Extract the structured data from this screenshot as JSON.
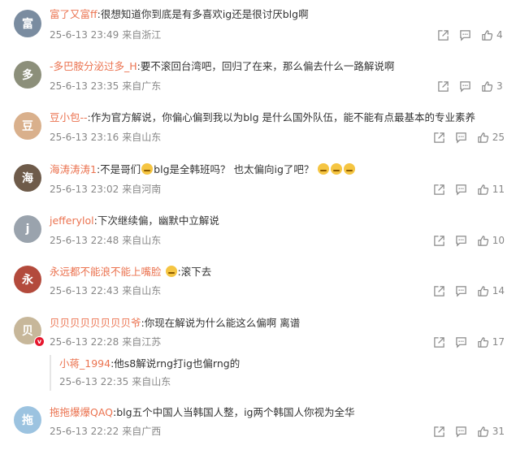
{
  "comments": [
    {
      "user": "富了又富ff",
      "text": ":很想知道你到底是有多喜欢ig还是很讨厌blg啊",
      "time": "25-6-13 23:49",
      "loc": "来自浙江",
      "likes": "4",
      "avatar_color": "#7a8ca0"
    },
    {
      "user": "-多巴胺分泌过多_H",
      "text": ":要不滚回台湾吧，回归了在来，那么偏去什么一路解说啊",
      "time": "25-6-13 23:35",
      "loc": "来自广东",
      "likes": "3",
      "avatar_color": "#8c8f7a"
    },
    {
      "user": "豆小包--",
      "text": ":作为官方解说，你偏心偏到我以为blg 是什么国外队伍，能不能有点最基本的专业素养",
      "time": "25-6-13 23:16",
      "loc": "来自山东",
      "likes": "25",
      "avatar_color": "#d9b08c"
    },
    {
      "user": "海涛涛涛1",
      "text": ":不是哥们",
      "text2": "blg是全韩班吗？ 也太偏向ig了吧？",
      "time": "25-6-13 23:02",
      "loc": "来自河南",
      "likes": "11",
      "avatar_color": "#6e5b4a"
    },
    {
      "user": "jefferylol",
      "text": ":下次继续偏，幽默中立解说",
      "time": "25-6-13 22:48",
      "loc": "来自山东",
      "likes": "10",
      "avatar_color": "#9aa3ad"
    },
    {
      "user": "永远都不能浪不能上嘴脸",
      "text": ":滚下去",
      "time": "25-6-13 22:43",
      "loc": "来自山东",
      "likes": "14",
      "avatar_color": "#b34a3c"
    },
    {
      "user": "贝贝贝贝贝贝贝贝爷",
      "text": ":你现在解说为什么能这么偏啊 离谱",
      "time": "25-6-13 22:28",
      "loc": "来自江苏",
      "likes": "17",
      "avatar_color": "#c7b79a"
    },
    {
      "user": "拖拖爆爆QAQ",
      "text": ":blg五个中国人当韩国人整，ig两个韩国人你视为全华",
      "time": "25-6-13 22:22",
      "loc": "来自广西",
      "likes": "31",
      "avatar_color": "#9cc3e0"
    }
  ],
  "reply": {
    "user": "小蒋_1994",
    "text": ":他s8解说rng打ig也偏rng的",
    "time": "25-6-13 22:35",
    "loc": "来自山东"
  },
  "icons": {
    "share": "share-icon",
    "comment": "comment-icon",
    "like": "thumbs-up-icon",
    "badge": "verified-badge-icon"
  },
  "colors": {
    "username": "#eb7350",
    "text": "#333333",
    "meta": "#888888",
    "badge": "#e6162d"
  }
}
